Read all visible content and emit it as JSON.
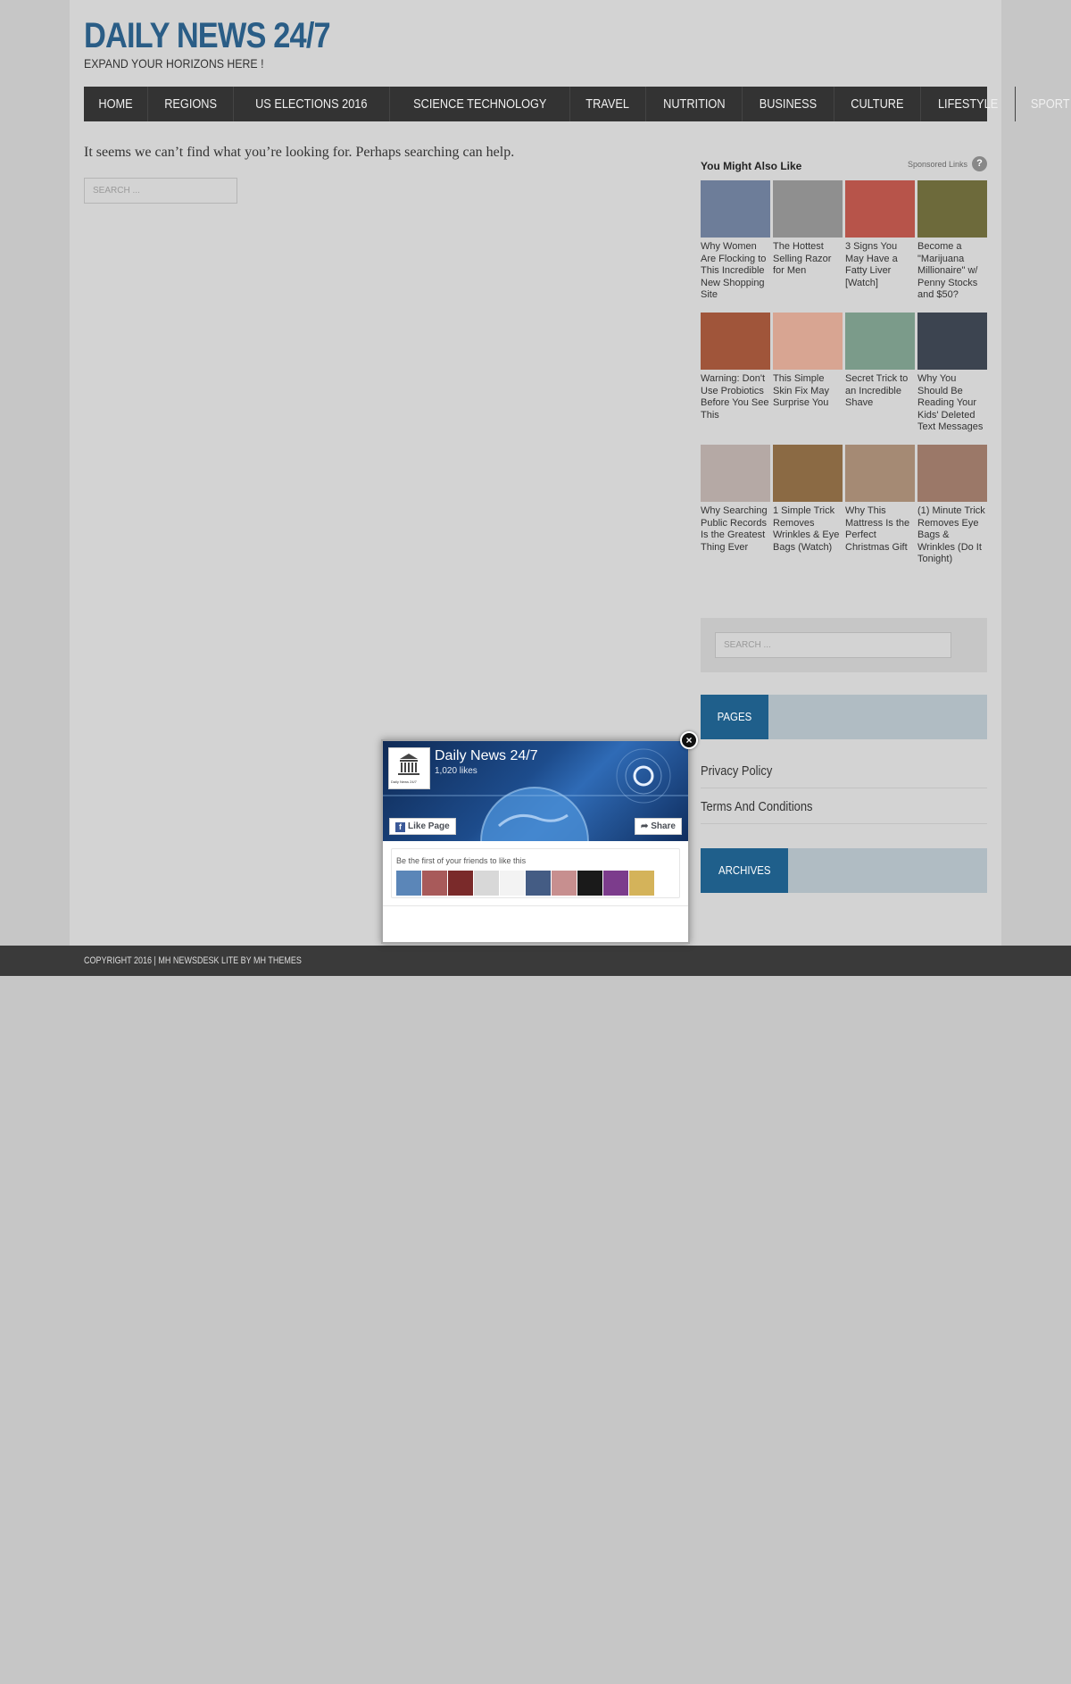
{
  "site": {
    "title": "DAILY NEWS 24/7",
    "tagline": "EXPAND YOUR HORIZONS HERE !"
  },
  "nav": [
    {
      "label": "HOME"
    },
    {
      "label": "REGIONS"
    },
    {
      "label": "US ELECTIONS 2016"
    },
    {
      "label": "SCIENCE TECHNOLOGY"
    },
    {
      "label": "TRAVEL"
    },
    {
      "label": "NUTRITION"
    },
    {
      "label": "BUSINESS"
    },
    {
      "label": "CULTURE"
    },
    {
      "label": "LIFESTYLE"
    },
    {
      "label": "SPORT"
    }
  ],
  "main": {
    "not_found_text": "It seems we can’t find what you’re looking for. Perhaps searching can help.",
    "search_placeholder": "SEARCH ..."
  },
  "sponsored": {
    "title": "You Might Also Like",
    "links_label": "Sponsored Links",
    "help_icon": "?",
    "items": [
      {
        "caption": "Why Women Are Flocking to This Incredible New Shopping Site",
        "color": "#6d7d99"
      },
      {
        "caption": "The Hottest Selling Razor for Men",
        "color": "#8f8f8f"
      },
      {
        "caption": "3 Signs You May Have a Fatty Liver [Watch]",
        "color": "#b7544a"
      },
      {
        "caption": "Become a \"Marijuana Millionaire\" w/ Penny Stocks and $50?",
        "color": "#6d6a3b"
      },
      {
        "caption": "Warning: Don't Use Probiotics Before You See This",
        "color": "#a0553a"
      },
      {
        "caption": "This Simple Skin Fix May Surprise You",
        "color": "#d8a592"
      },
      {
        "caption": "Secret Trick to an Incredible Shave",
        "color": "#7b9b8a"
      },
      {
        "caption": "Why You Should Be Reading Your Kids' Deleted Text Messages",
        "color": "#3c4450"
      },
      {
        "caption": "Why Searching Public Records Is the Greatest Thing Ever",
        "color": "#b5a9a5"
      },
      {
        "caption": "1 Simple Trick Removes Wrinkles & Eye Bags (Watch)",
        "color": "#8b6a44"
      },
      {
        "caption": "Why This Mattress Is the Perfect Christmas Gift",
        "color": "#a58a74"
      },
      {
        "caption": "(1) Minute Trick Removes Eye Bags & Wrinkles (Do It Tonight)",
        "color": "#9b7868"
      }
    ]
  },
  "sidebar": {
    "search_placeholder": "SEARCH ...",
    "pages_title": "PAGES",
    "pages": [
      {
        "label": "Privacy Policy"
      },
      {
        "label": "Terms And Conditions"
      }
    ],
    "archives_title": "ARCHIVES"
  },
  "footer": {
    "text": "COPYRIGHT 2016 | MH NEWSDESK LITE BY MH THEMES"
  },
  "fb_popup": {
    "page_name": "Daily News 24/7",
    "likes": "1,020 likes",
    "like_button": "Like Page",
    "share_button": "Share",
    "friends_text": "Be the first of your friends to like this",
    "close_icon": "×",
    "logo_caption": "Daily News 24/7",
    "friend_colors": [
      "#5b86b8",
      "#a85a5a",
      "#7a2a2a",
      "#d8d8d8",
      "#f3f3f3",
      "#445c84",
      "#c78f8f",
      "#1a1a1a",
      "#7c3c8c",
      "#d4b35a"
    ]
  }
}
